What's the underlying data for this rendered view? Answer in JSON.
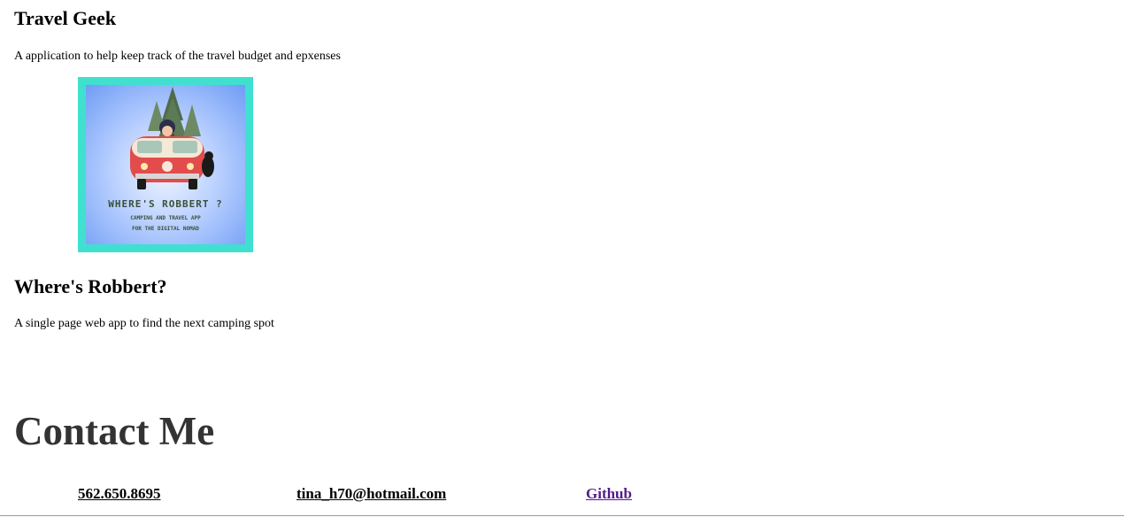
{
  "projects": [
    {
      "title": "Travel Geek",
      "description": "A application to help keep track of the travel budget and epxenses"
    },
    {
      "title": "Where's Robbert?",
      "description": "A single page web app to find the next camping spot",
      "logo": {
        "headline": "WHERE'S ROBBERT ?",
        "tagline_1": "CAMPING AND TRAVEL APP",
        "tagline_2": "FOR THE DIGITAL NOMAD",
        "border_color": "#3fe0d0"
      }
    }
  ],
  "contact": {
    "heading": "Contact Me",
    "phone": "562.650.8695",
    "email": "tina_h70@hotmail.com",
    "github": "Github"
  },
  "colors": {
    "link_visited": "#551a8b",
    "heading_dark": "#333333"
  }
}
